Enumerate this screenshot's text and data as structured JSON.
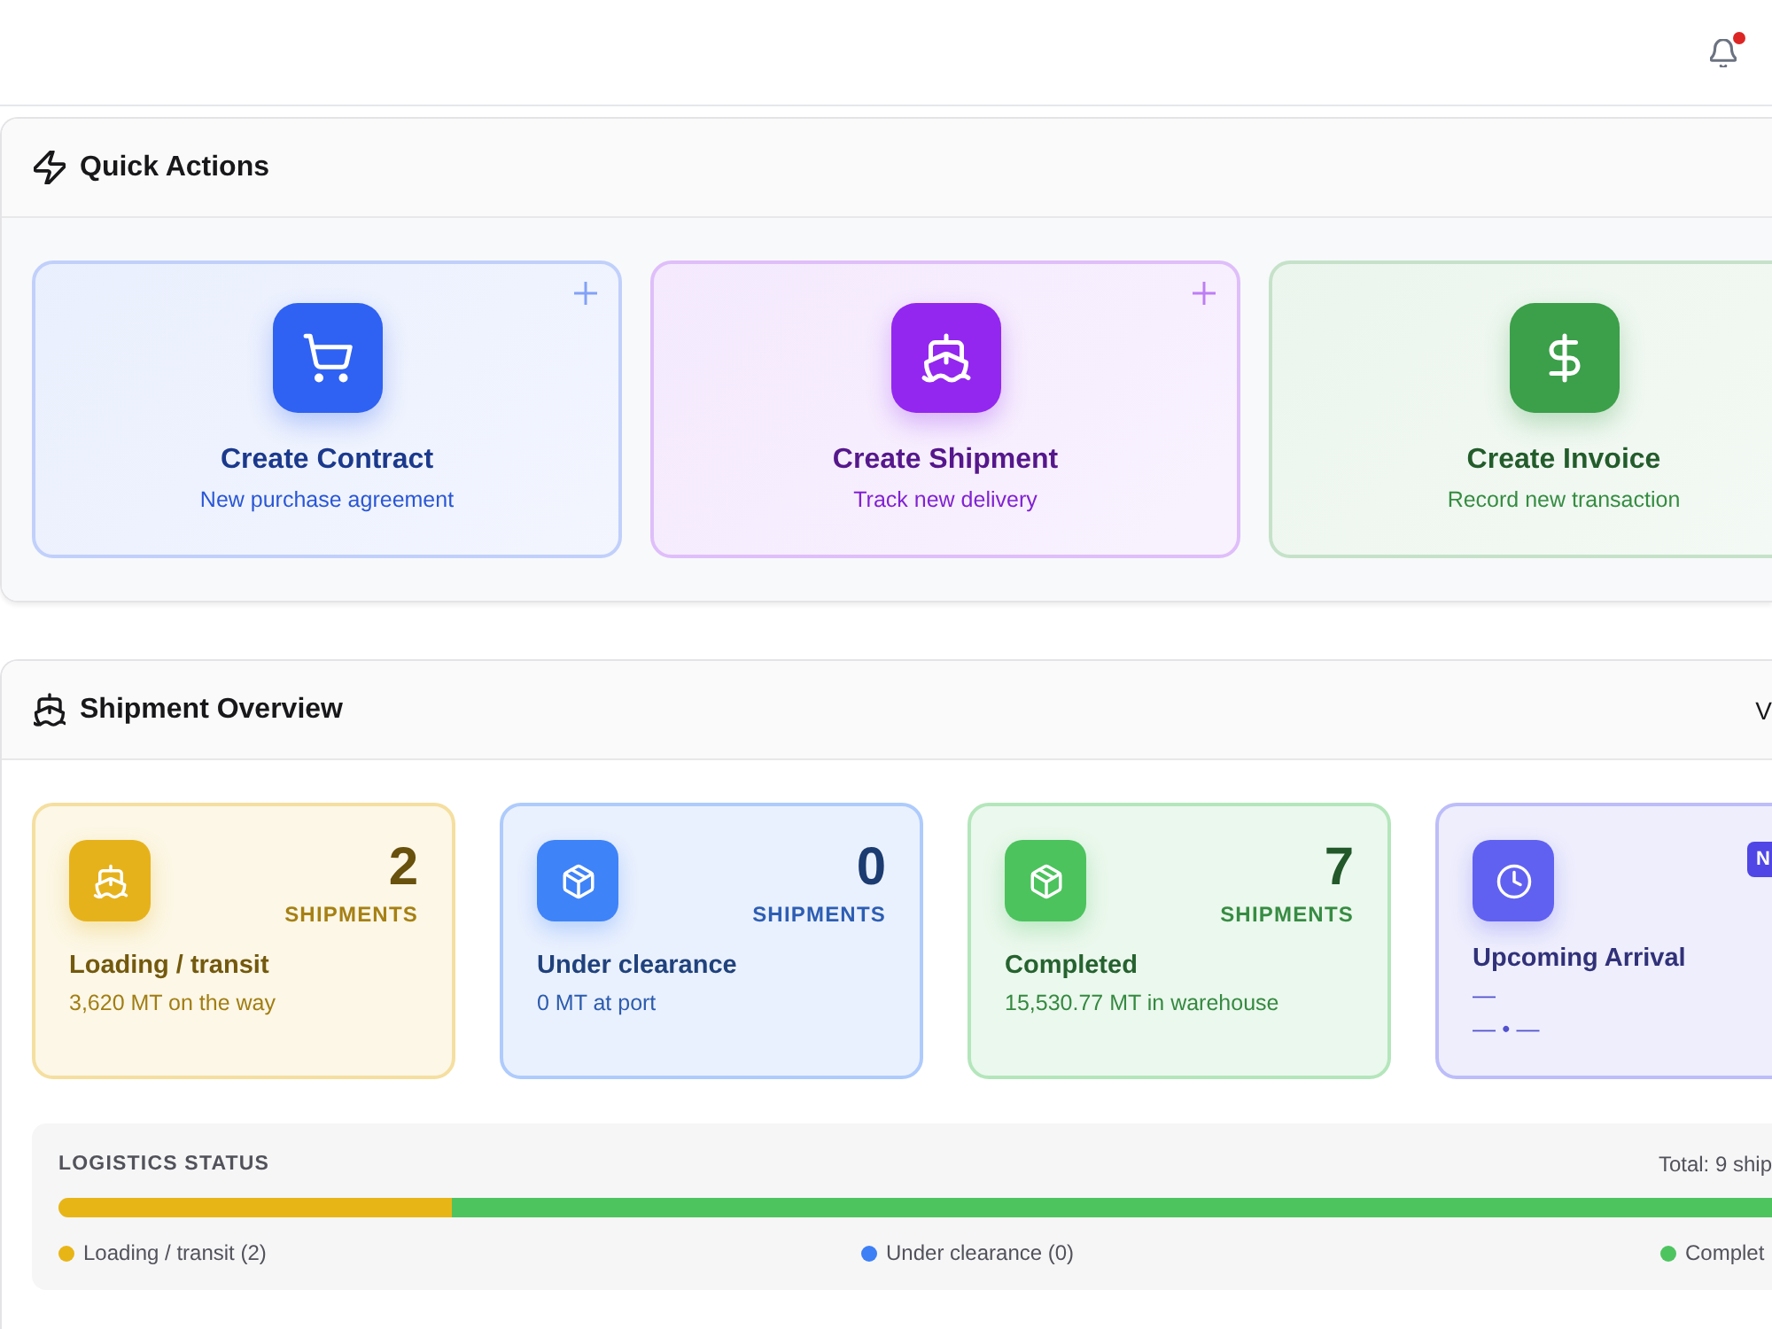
{
  "header": {
    "notifications": {
      "unread": true
    }
  },
  "quick_actions": {
    "title": "Quick Actions",
    "cards": [
      {
        "title": "Create Contract",
        "subtitle": "New purchase agreement",
        "color": "#2f62f2",
        "add_icon": true
      },
      {
        "title": "Create Shipment",
        "subtitle": "Track new delivery",
        "color": "#9327ef",
        "add_icon": true
      },
      {
        "title": "Create Invoice",
        "subtitle": "Record new transaction",
        "color": "#3c9f4a",
        "add_icon": false
      }
    ]
  },
  "shipment_overview": {
    "title": "Shipment Overview",
    "link": "V",
    "cards": [
      {
        "kind": "count",
        "count": "2",
        "unit": "SHIPMENTS",
        "title": "Loading / transit",
        "subtitle": "3,620 MT on the way",
        "color": "#e6b21c"
      },
      {
        "kind": "count",
        "count": "0",
        "unit": "SHIPMENTS",
        "title": "Under clearance",
        "subtitle": "0 MT at port",
        "color": "#3f83f8"
      },
      {
        "kind": "count",
        "count": "7",
        "unit": "SHIPMENTS",
        "title": "Completed",
        "subtitle": "15,530.77 MT in warehouse",
        "color": "#4cc35d"
      },
      {
        "kind": "arrival",
        "badge": "N",
        "title": "Upcoming Arrival",
        "lines": [
          "—",
          "— • —"
        ],
        "color": "#6161f1"
      }
    ],
    "logistics": {
      "title": "LOGISTICS STATUS",
      "total": "Total: 9 ship",
      "segments": [
        {
          "label": "Loading / transit (2)",
          "color": "#e8b516",
          "level": 0.23
        },
        {
          "label": "Under clearance (0)",
          "color": "#3d7ff5"
        },
        {
          "label": "Complet",
          "color": "#4ec45f",
          "level": 0.77
        }
      ]
    }
  }
}
